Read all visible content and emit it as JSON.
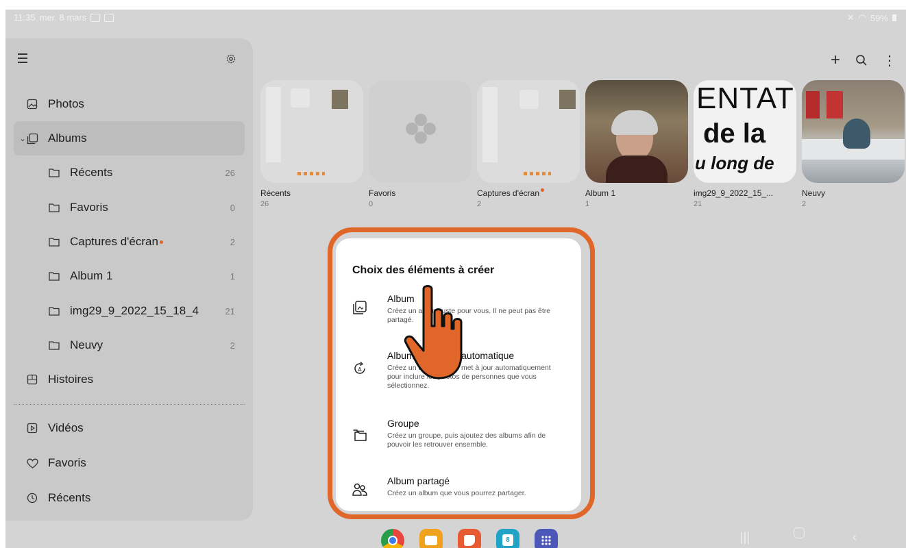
{
  "status_bar": {
    "time": "11:35",
    "date": "mer. 8 mars",
    "battery": "59%"
  },
  "sidebar": {
    "items": [
      {
        "label": "Photos",
        "icon": "image-icon"
      },
      {
        "label": "Albums",
        "icon": "albums-icon"
      },
      {
        "label": "Récents",
        "count": "26"
      },
      {
        "label": "Favoris",
        "count": "0"
      },
      {
        "label": "Captures d'écran",
        "count": "2"
      },
      {
        "label": "Album 1",
        "count": "1"
      },
      {
        "label": "img29_9_2022_15_18_4",
        "count": "21"
      },
      {
        "label": "Neuvy",
        "count": "2"
      },
      {
        "label": "Histoires",
        "icon": "stories-icon"
      },
      {
        "label": "Vidéos",
        "icon": "video-icon"
      },
      {
        "label": "Favoris",
        "icon": "heart-icon"
      },
      {
        "label": "Récents",
        "icon": "clock-icon"
      }
    ]
  },
  "albums": [
    {
      "name": "Récents",
      "count": "26"
    },
    {
      "name": "Favoris",
      "count": "0"
    },
    {
      "name": "Captures d'écran",
      "count": "2"
    },
    {
      "name": "Album 1",
      "count": "1"
    },
    {
      "name": "img29_9_2022_15_...",
      "count": "21"
    },
    {
      "name": "Neuvy",
      "count": "2"
    }
  ],
  "thumb_text": {
    "line1": "ENTAT",
    "line2": "de la",
    "line3": "u long de"
  },
  "dialog": {
    "title": "Choix des éléments à créer",
    "options": [
      {
        "title": "Album",
        "desc": "Créez un album juste pour vous. Il ne peut pas être partagé."
      },
      {
        "title": "Album mis à jour automatique",
        "desc": "Créez un album qui se met à jour automatiquement pour inclure les photos de personnes que vous sélectionnez."
      },
      {
        "title": "Groupe",
        "desc": "Créez un groupe, puis ajoutez des albums afin de pouvoir les retrouver ensemble."
      },
      {
        "title": "Album partagé",
        "desc": "Créez un album que vous pourrez partager."
      }
    ]
  },
  "dock": {
    "apps": [
      "chrome-icon",
      "files-icon",
      "notes-icon",
      "calendar-icon",
      "apps-grid-icon"
    ],
    "calendar_day": "8"
  },
  "colors": {
    "accent": "#e0662a",
    "background": "#d4d4d4",
    "sidebar": "#c9c9c9"
  }
}
